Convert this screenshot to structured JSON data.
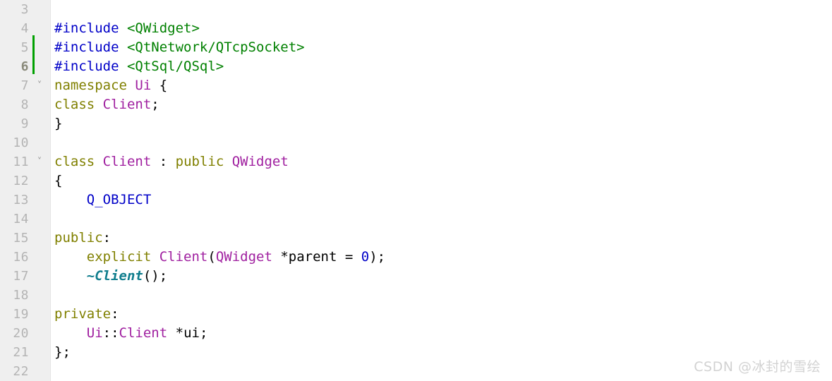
{
  "editor": {
    "gutter_bg": "#efefef",
    "background": "#ffffff",
    "change_bar_color": "#00a000",
    "current_line": 6,
    "first_visible_line": 3,
    "last_visible_line": 22,
    "fold_icon": "˅",
    "lines": [
      {
        "number": "3",
        "fold": "",
        "current": false,
        "changed": false,
        "tokens": []
      },
      {
        "number": "4",
        "fold": "",
        "current": false,
        "changed": false,
        "tokens": [
          {
            "text": "#include ",
            "type": "pre"
          },
          {
            "text": "<QWidget>",
            "type": "str"
          }
        ]
      },
      {
        "number": "5",
        "fold": "",
        "current": false,
        "changed": true,
        "tokens": [
          {
            "text": "#include ",
            "type": "pre"
          },
          {
            "text": "<QtNetwork/QTcpSocket>",
            "type": "str"
          }
        ]
      },
      {
        "number": "6",
        "fold": "",
        "current": true,
        "changed": true,
        "tokens": [
          {
            "text": "#include ",
            "type": "pre"
          },
          {
            "text": "<QtSql/QSql>",
            "type": "str"
          }
        ]
      },
      {
        "number": "7",
        "fold": "˅",
        "current": false,
        "changed": false,
        "tokens": [
          {
            "text": "namespace",
            "type": "kw"
          },
          {
            "text": " ",
            "type": "plain"
          },
          {
            "text": "Ui",
            "type": "type"
          },
          {
            "text": " {",
            "type": "plain"
          }
        ]
      },
      {
        "number": "8",
        "fold": "",
        "current": false,
        "changed": false,
        "tokens": [
          {
            "text": "class",
            "type": "kw"
          },
          {
            "text": " ",
            "type": "plain"
          },
          {
            "text": "Client",
            "type": "type"
          },
          {
            "text": ";",
            "type": "plain"
          }
        ]
      },
      {
        "number": "9",
        "fold": "",
        "current": false,
        "changed": false,
        "tokens": [
          {
            "text": "}",
            "type": "plain"
          }
        ]
      },
      {
        "number": "10",
        "fold": "",
        "current": false,
        "changed": false,
        "tokens": []
      },
      {
        "number": "11",
        "fold": "˅",
        "current": false,
        "changed": false,
        "tokens": [
          {
            "text": "class",
            "type": "kw"
          },
          {
            "text": " ",
            "type": "plain"
          },
          {
            "text": "Client",
            "type": "type"
          },
          {
            "text": " : ",
            "type": "plain"
          },
          {
            "text": "public",
            "type": "kw"
          },
          {
            "text": " ",
            "type": "plain"
          },
          {
            "text": "QWidget",
            "type": "type"
          }
        ]
      },
      {
        "number": "12",
        "fold": "",
        "current": false,
        "changed": false,
        "tokens": [
          {
            "text": "{",
            "type": "plain"
          }
        ]
      },
      {
        "number": "13",
        "fold": "",
        "current": false,
        "changed": false,
        "tokens": [
          {
            "text": "    Q_OBJECT",
            "type": "macro"
          }
        ]
      },
      {
        "number": "14",
        "fold": "",
        "current": false,
        "changed": false,
        "tokens": []
      },
      {
        "number": "15",
        "fold": "",
        "current": false,
        "changed": false,
        "tokens": [
          {
            "text": "public",
            "type": "kw"
          },
          {
            "text": ":",
            "type": "plain"
          }
        ]
      },
      {
        "number": "16",
        "fold": "",
        "current": false,
        "changed": false,
        "tokens": [
          {
            "text": "    ",
            "type": "plain"
          },
          {
            "text": "explicit",
            "type": "kw"
          },
          {
            "text": " ",
            "type": "plain"
          },
          {
            "text": "Client",
            "type": "type"
          },
          {
            "text": "(",
            "type": "plain"
          },
          {
            "text": "QWidget",
            "type": "type"
          },
          {
            "text": " *parent = ",
            "type": "plain"
          },
          {
            "text": "0",
            "type": "num"
          },
          {
            "text": ");",
            "type": "plain"
          }
        ]
      },
      {
        "number": "17",
        "fold": "",
        "current": false,
        "changed": false,
        "tokens": [
          {
            "text": "    ",
            "type": "plain"
          },
          {
            "text": "~Client",
            "type": "virt"
          },
          {
            "text": "();",
            "type": "plain"
          }
        ]
      },
      {
        "number": "18",
        "fold": "",
        "current": false,
        "changed": false,
        "tokens": []
      },
      {
        "number": "19",
        "fold": "",
        "current": false,
        "changed": false,
        "tokens": [
          {
            "text": "private",
            "type": "kw"
          },
          {
            "text": ":",
            "type": "plain"
          }
        ]
      },
      {
        "number": "20",
        "fold": "",
        "current": false,
        "changed": false,
        "tokens": [
          {
            "text": "    ",
            "type": "plain"
          },
          {
            "text": "Ui",
            "type": "type"
          },
          {
            "text": "::",
            "type": "plain"
          },
          {
            "text": "Client",
            "type": "type"
          },
          {
            "text": " *ui;",
            "type": "plain"
          }
        ]
      },
      {
        "number": "21",
        "fold": "",
        "current": false,
        "changed": false,
        "tokens": [
          {
            "text": "};",
            "type": "plain"
          }
        ]
      },
      {
        "number": "22",
        "fold": "",
        "current": false,
        "changed": false,
        "tokens": []
      }
    ]
  },
  "watermark": {
    "text": "CSDN @冰封的雪绘"
  }
}
